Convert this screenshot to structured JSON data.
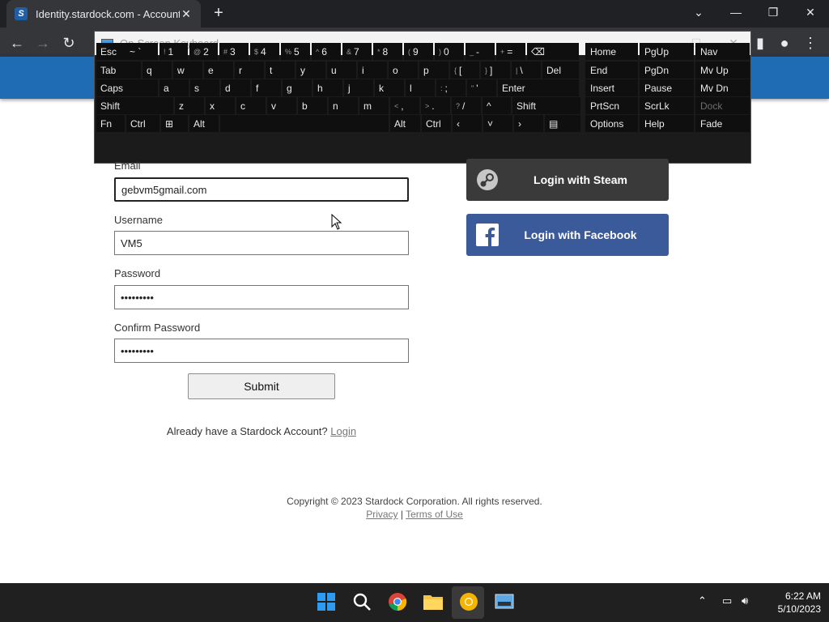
{
  "browser": {
    "tab_title": "Identity.stardock.com - Account I",
    "new_tab_glyph": "+",
    "tab_close_glyph": "✕"
  },
  "osk": {
    "title": "On-Screen Keyboard",
    "rows": [
      [
        {
          "label": "Esc"
        },
        {
          "label": "~ `"
        },
        {
          "label": "1",
          "sub": "!"
        },
        {
          "label": "2",
          "sub": "@"
        },
        {
          "label": "3",
          "sub": "#"
        },
        {
          "label": "4",
          "sub": "$"
        },
        {
          "label": "5",
          "sub": "%"
        },
        {
          "label": "6",
          "sub": "^"
        },
        {
          "label": "7",
          "sub": "&"
        },
        {
          "label": "8",
          "sub": "*"
        },
        {
          "label": "9",
          "sub": "("
        },
        {
          "label": "0",
          "sub": ")"
        },
        {
          "label": "-",
          "sub": "_"
        },
        {
          "label": "=",
          "sub": "+"
        },
        {
          "label": "⌫"
        }
      ],
      [
        {
          "label": "Tab"
        },
        {
          "label": "q"
        },
        {
          "label": "w"
        },
        {
          "label": "e"
        },
        {
          "label": "r"
        },
        {
          "label": "t"
        },
        {
          "label": "y"
        },
        {
          "label": "u"
        },
        {
          "label": "i"
        },
        {
          "label": "o"
        },
        {
          "label": "p"
        },
        {
          "label": "[",
          "sub": "{"
        },
        {
          "label": "]",
          "sub": "}"
        },
        {
          "label": "\\",
          "sub": "|"
        },
        {
          "label": "Del"
        }
      ],
      [
        {
          "label": "Caps"
        },
        {
          "label": "a"
        },
        {
          "label": "s"
        },
        {
          "label": "d"
        },
        {
          "label": "f"
        },
        {
          "label": "g"
        },
        {
          "label": "h"
        },
        {
          "label": "j"
        },
        {
          "label": "k"
        },
        {
          "label": "l"
        },
        {
          "label": ";",
          "sub": ":"
        },
        {
          "label": "'",
          "sub": "\""
        },
        {
          "label": "Enter"
        }
      ],
      [
        {
          "label": "Shift"
        },
        {
          "label": "z"
        },
        {
          "label": "x"
        },
        {
          "label": "c"
        },
        {
          "label": "v"
        },
        {
          "label": "b"
        },
        {
          "label": "n"
        },
        {
          "label": "m"
        },
        {
          "label": ",",
          "sub": "<"
        },
        {
          "label": ".",
          "sub": ">"
        },
        {
          "label": "/",
          "sub": "?"
        },
        {
          "label": "^"
        },
        {
          "label": "Shift"
        }
      ],
      [
        {
          "label": "Fn"
        },
        {
          "label": "Ctrl"
        },
        {
          "label": "⊞"
        },
        {
          "label": "Alt"
        },
        {
          "label": ""
        },
        {
          "label": "Alt"
        },
        {
          "label": "Ctrl"
        },
        {
          "label": "‹"
        },
        {
          "label": "˅"
        },
        {
          "label": "›"
        },
        {
          "label": "▤"
        }
      ]
    ],
    "nav_rows": [
      [
        "Home",
        "PgUp",
        "Nav"
      ],
      [
        "End",
        "PgDn",
        "Mv Up"
      ],
      [
        "Insert",
        "Pause",
        "Mv Dn"
      ],
      [
        "PrtScn",
        "ScrLk",
        "Dock"
      ],
      [
        "Options",
        "Help",
        "Fade"
      ]
    ]
  },
  "form": {
    "email_label": "Email",
    "email_value": "gebvm5gmail.com",
    "username_label": "Username",
    "username_value": "VM5",
    "password_label": "Password",
    "password_value": "•••••••••",
    "confirm_label": "Confirm Password",
    "confirm_value": "•••••••••",
    "submit_label": "Submit",
    "already_text": "Already have a Stardock Account?",
    "login_link": "Login"
  },
  "social": {
    "steam_label": "Login with Steam",
    "facebook_label": "Login with Facebook"
  },
  "footer": {
    "copyright": "Copyright © 2023 Stardock Corporation. All rights reserved.",
    "privacy": "Privacy",
    "separator": "|",
    "terms": "Terms of Use"
  },
  "taskbar": {
    "time": "6:22 AM",
    "date": "5/10/2023"
  }
}
